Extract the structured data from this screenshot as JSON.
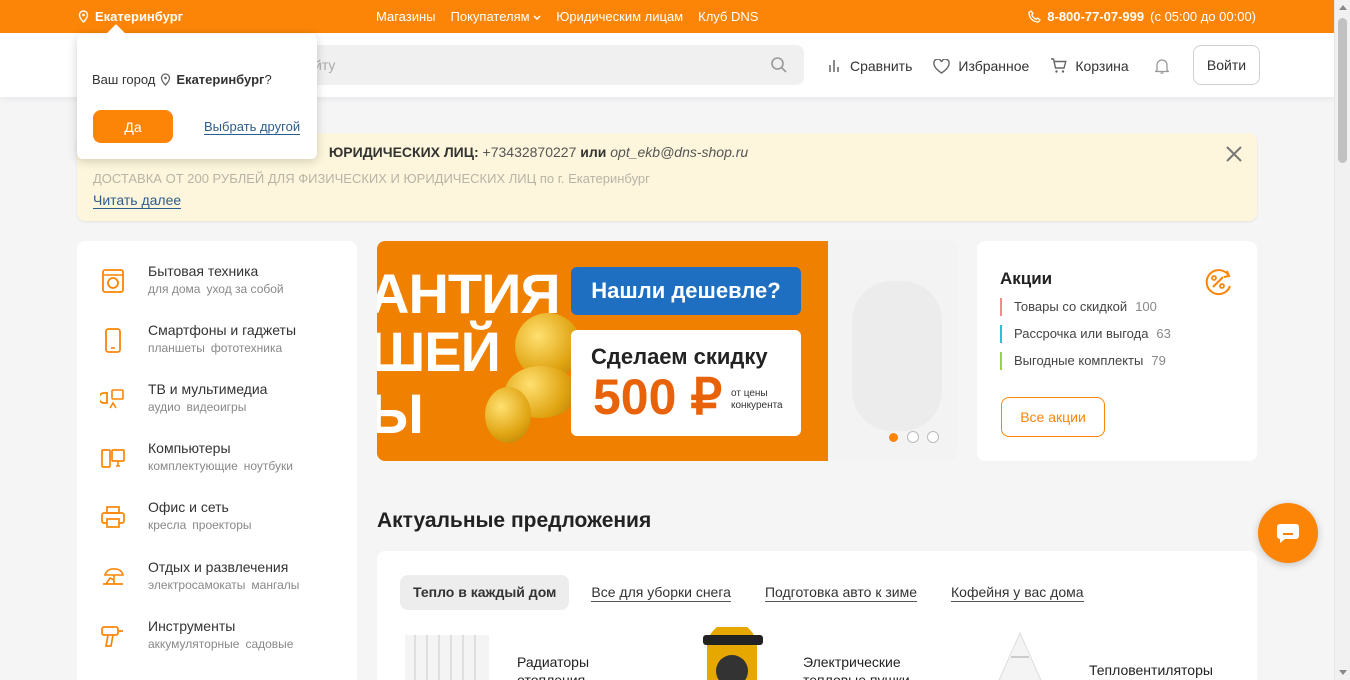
{
  "topbar": {
    "city": "Екатеринбург",
    "nav": [
      "Магазины",
      "Покупателям",
      "Юридическим лицам",
      "Клуб DNS"
    ],
    "phone": "8-800-77-07-999",
    "hours": "(с 05:00 до 00:00)"
  },
  "header": {
    "search_placeholder": "йту",
    "compare": "Сравнить",
    "favorites": "Избранное",
    "cart": "Корзина",
    "login": "Войти"
  },
  "city_popup": {
    "question_prefix": "Ваш город",
    "city": "Екатеринбург",
    "question_suffix": "?",
    "yes": "Да",
    "choose_other": "Выбрать другой"
  },
  "notice": {
    "line1_bold": "ЮРИДИЧЕСКИХ ЛИЦ:",
    "phone": "+73432870227",
    "or": "или",
    "email": "opt_ekb@dns-shop.ru",
    "line2": "Доставка от 200 рублей для физических и юридических лиц",
    "line2_tail": "по г. Екатеринбург",
    "read_more": "Читать далее"
  },
  "catalog": [
    {
      "title": "Бытовая техника",
      "subs": [
        "для дома",
        "уход за собой"
      ],
      "icon": "washing-machine-icon"
    },
    {
      "title": "Смартфоны и гаджеты",
      "subs": [
        "планшеты",
        "фототехника"
      ],
      "icon": "smartphone-icon"
    },
    {
      "title": "ТВ и мультимедиа",
      "subs": [
        "аудио",
        "видеоигры"
      ],
      "icon": "tv-media-icon"
    },
    {
      "title": "Компьютеры",
      "subs": [
        "комплектующие",
        "ноутбуки"
      ],
      "icon": "computer-icon"
    },
    {
      "title": "Офис и сеть",
      "subs": [
        "кресла",
        "проекторы"
      ],
      "icon": "printer-icon"
    },
    {
      "title": "Отдых и развлечения",
      "subs": [
        "электросамокаты",
        "мангалы"
      ],
      "icon": "leisure-icon"
    },
    {
      "title": "Инструменты",
      "subs": [
        "аккумуляторные",
        "садовые"
      ],
      "icon": "drill-icon"
    }
  ],
  "banner": {
    "line1": "АНТИЯ",
    "line2": "ШЕЙ",
    "line3": "Ы",
    "pill": "Нашли дешевле?",
    "card_title": "Сделаем скидку",
    "price": "500 ₽",
    "price_note": "от цены конкурента",
    "slides": 3,
    "active_slide": 1
  },
  "promo": {
    "title": "Акции",
    "rows": [
      {
        "label": "Товары со скидкой",
        "count": "100",
        "color": "#f08c8c"
      },
      {
        "label": "Рассрочка или выгода",
        "count": "63",
        "color": "#2bc0d3"
      },
      {
        "label": "Выгодные комплекты",
        "count": "79",
        "color": "#9ad14a"
      }
    ],
    "all_button": "Все акции"
  },
  "offers": {
    "title": "Актуальные предложения",
    "tabs": [
      "Тепло в каждый дом",
      "Все для уборки снега",
      "Подготовка авто к зиме",
      "Кофейня у вас дома"
    ],
    "products": [
      {
        "line1": "Радиаторы",
        "line2": "отопления"
      },
      {
        "line1": "Электрические",
        "line2": "тепловые пушки"
      },
      {
        "line1": "Тепловентиляторы",
        "line2": ""
      }
    ]
  },
  "colors": {
    "accent": "#fc8507",
    "link": "#2a5d8e",
    "notice_bg": "#fdf6dc"
  }
}
